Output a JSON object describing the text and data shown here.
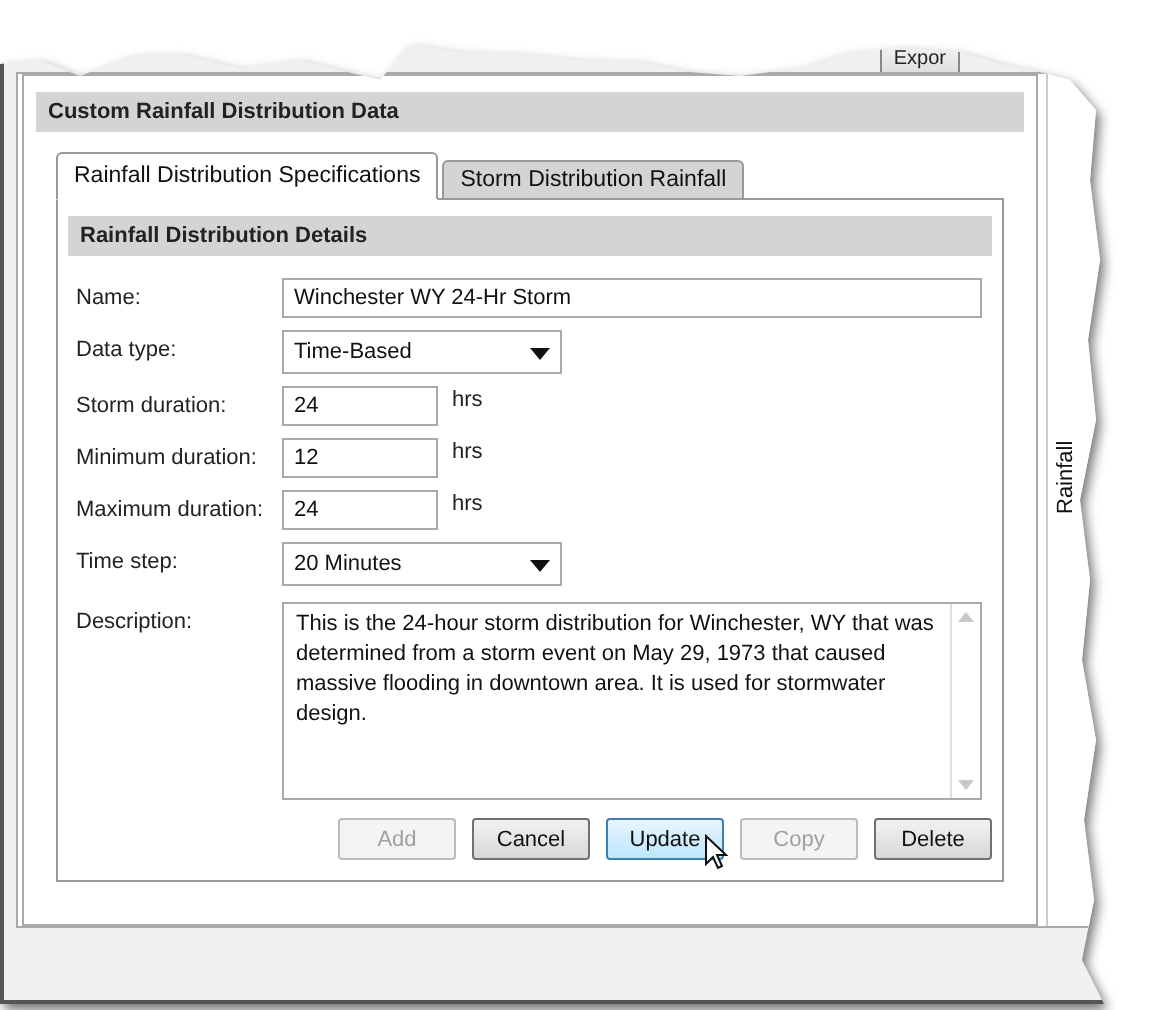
{
  "toolbar": {
    "buttons": [
      "Expor"
    ]
  },
  "group_title": "Custom Rainfall Distribution Data",
  "tabs": [
    {
      "label": "Rainfall Distribution Specifications",
      "selected": true
    },
    {
      "label": "Storm Distribution Rainfall",
      "selected": false
    }
  ],
  "section_title": "Rainfall Distribution Details",
  "fields": [
    {
      "kind": "text",
      "label": "Name:",
      "value": "Winchester WY 24-Hr Storm"
    },
    {
      "kind": "select",
      "label": "Data type:",
      "value": "Time-Based"
    },
    {
      "kind": "number",
      "label": "Storm duration:",
      "value": "24",
      "unit": "hrs"
    },
    {
      "kind": "number",
      "label": "Minimum duration:",
      "value": "12",
      "unit": "hrs"
    },
    {
      "kind": "number",
      "label": "Maximum duration:",
      "value": "24",
      "unit": "hrs"
    },
    {
      "kind": "select",
      "label": "Time step:",
      "value": "20 Minutes"
    },
    {
      "kind": "textarea",
      "label": "Description:",
      "value": "This is the 24-hour storm distribution for Winchester, WY that was determined from a storm event on May 29, 1973 that caused massive flooding in downtown area. It is used for stormwater design."
    }
  ],
  "buttons": [
    {
      "label": "Add",
      "disabled": true,
      "hover": false
    },
    {
      "label": "Cancel",
      "disabled": false,
      "hover": false
    },
    {
      "label": "Update",
      "disabled": false,
      "hover": true
    },
    {
      "label": "Copy",
      "disabled": true,
      "hover": false
    },
    {
      "label": "Delete",
      "disabled": false,
      "hover": false
    }
  ],
  "chart_axis_label": "Rainfall"
}
